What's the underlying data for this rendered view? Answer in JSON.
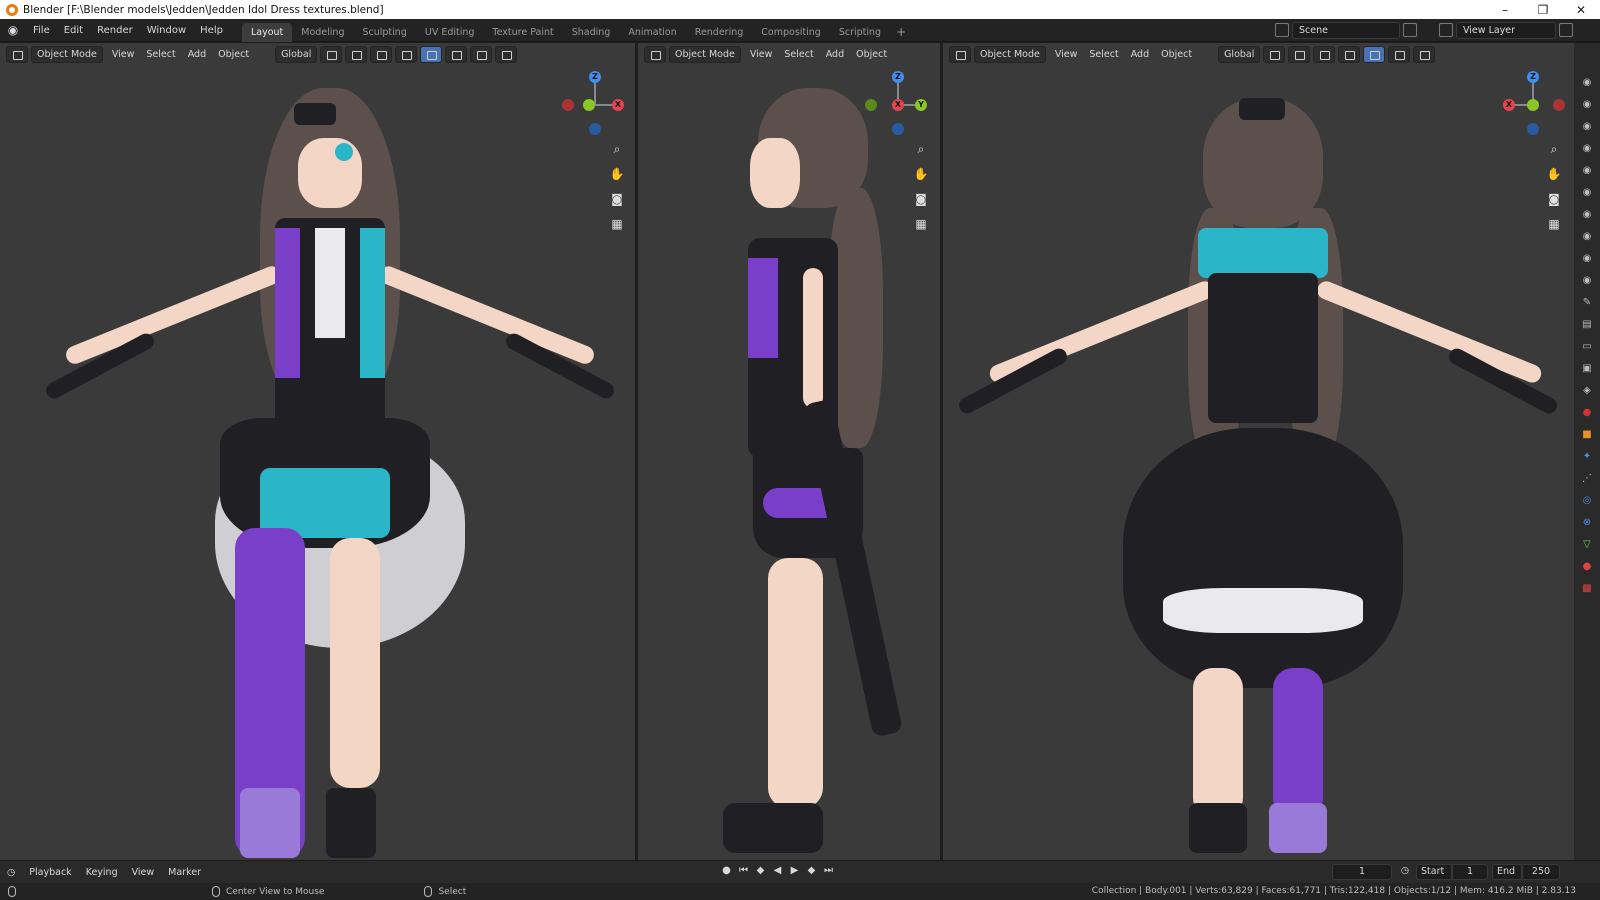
{
  "window": {
    "title": "Blender [F:\\Blender models\\Jedden\\Jedden Idol Dress textures.blend]",
    "controls": [
      "–",
      "❐",
      "✕"
    ]
  },
  "topbar": {
    "menus": [
      "File",
      "Edit",
      "Render",
      "Window",
      "Help"
    ],
    "workspaces": [
      "Layout",
      "Modeling",
      "Sculpting",
      "UV Editing",
      "Texture Paint",
      "Shading",
      "Animation",
      "Rendering",
      "Compositing",
      "Scripting"
    ],
    "active_workspace": "Layout",
    "add_workspace": "+",
    "scene": "Scene",
    "view_layer": "View Layer"
  },
  "viewport_header": {
    "mode": "Object Mode",
    "menus": [
      "View",
      "Select",
      "Add",
      "Object"
    ],
    "orientation": "Global"
  },
  "gizmo_labels": {
    "x": "X",
    "y": "Y",
    "z": "Z"
  },
  "timeline": {
    "menus": [
      "Playback",
      "Keying",
      "View",
      "Marker"
    ],
    "current_frame": "1",
    "start_label": "Start",
    "start": "1",
    "end_label": "End",
    "end": "250"
  },
  "statusbar": {
    "hint_middle": "Center View to Mouse",
    "hint_left": "Select",
    "stats": "Collection | Body.001 | Verts:63,829 | Faces:61,771 | Tris:122,418 | Objects:1/12 | Mem: 416.2 MiB | 2.83.13"
  },
  "colors": {
    "axis_x": "#e8434f",
    "axis_y": "#8ac826",
    "axis_z": "#3d8ef0",
    "accent": "#4772b3",
    "viewport_bg": "#3a3a3a"
  }
}
